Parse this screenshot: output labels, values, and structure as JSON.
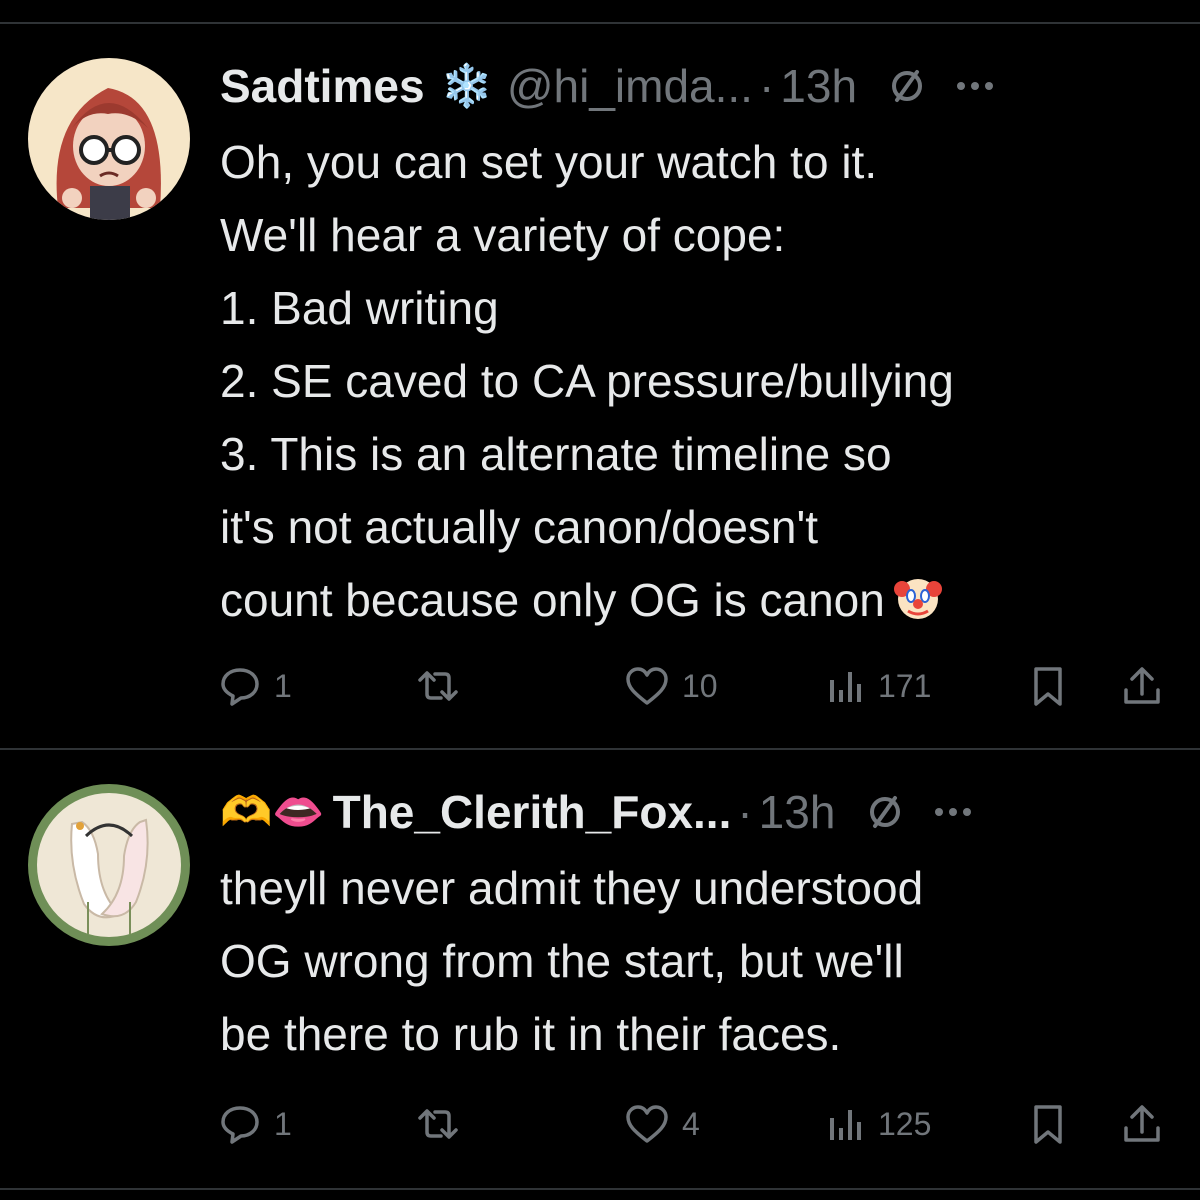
{
  "tweets": [
    {
      "name": "Sadtimes",
      "badge": "❄️",
      "handle": "@hi_imda...",
      "separator": "·",
      "time": "13h",
      "body": "Oh, you can set your watch to it.\nWe'll hear a variety of cope:\n1. Bad writing\n2. SE caved to CA pressure/bullying\n3. This is an alternate timeline so\nit's not actually canon/doesn't\ncount because only OG is canon",
      "trailing_emoji": "🤡",
      "replies": "1",
      "reposts": "",
      "likes": "10",
      "views": "171"
    },
    {
      "name_emojis": "🫶👄",
      "name": "The_Clerith_Fox...",
      "separator": "·",
      "time": "13h",
      "body": "theyll never admit they understood\nOG wrong from the start, but we'll\nbe there to rub it in their faces.",
      "replies": "1",
      "reposts": "",
      "likes": "4",
      "views": "125"
    }
  ],
  "icons": {
    "reply": "speech-bubble-icon",
    "repost": "repost-arrows-icon",
    "like": "heart-icon",
    "views": "bar-chart-icon",
    "bookmark": "bookmark-icon",
    "share": "share-upload-icon",
    "grok": "grok-slash-circle-icon",
    "more": "more-dots-icon"
  },
  "colors": {
    "background": "#000000",
    "text": "#e7e9ea",
    "secondary": "#71767b",
    "divider": "#2f3336"
  }
}
